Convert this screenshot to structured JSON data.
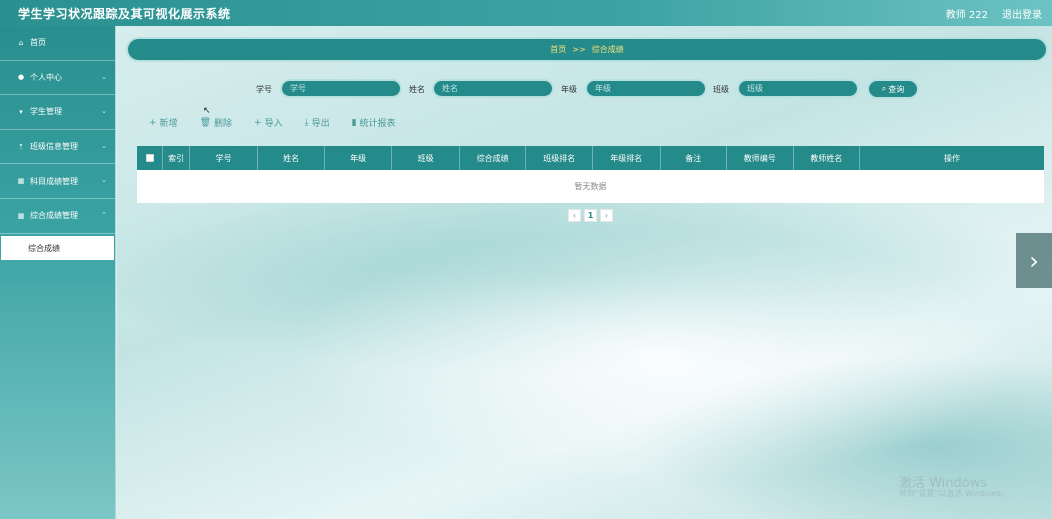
{
  "header": {
    "title": "学生学习状况跟踪及其可视化展示系统",
    "user": "教师 222",
    "logout": "退出登录"
  },
  "sidebar": {
    "items": [
      {
        "label": "首页",
        "icon": "home-icon",
        "has_children": false
      },
      {
        "label": "个人中心",
        "icon": "user-icon",
        "has_children": true
      },
      {
        "label": "学生管理",
        "icon": "student-icon",
        "has_children": true
      },
      {
        "label": "班级信息管理",
        "icon": "upload-icon",
        "has_children": true
      },
      {
        "label": "科目成绩管理",
        "icon": "grid-icon",
        "has_children": true
      },
      {
        "label": "综合成绩管理",
        "icon": "grid-icon",
        "has_children": true
      }
    ],
    "active_sub": "综合成绩"
  },
  "breadcrumb": {
    "home": "首页",
    "sep": ">>",
    "current": "综合成绩"
  },
  "search": {
    "fields": [
      {
        "label": "学号",
        "placeholder": "学号"
      },
      {
        "label": "姓名",
        "placeholder": "姓名"
      },
      {
        "label": "年级",
        "placeholder": "年级"
      },
      {
        "label": "班级",
        "placeholder": "班级"
      }
    ],
    "query_label": "查询"
  },
  "toolbar": {
    "add": "新增",
    "delete": "删除",
    "import": "导入",
    "export": "导出",
    "report": "统计报表"
  },
  "table": {
    "columns": [
      "索引",
      "学号",
      "姓名",
      "年级",
      "班级",
      "综合成绩",
      "班级排名",
      "年级排名",
      "备注",
      "教师编号",
      "教师姓名",
      "操作"
    ],
    "empty_text": "暂无数据"
  },
  "pager": {
    "prev": "‹",
    "page": "1",
    "next": "›"
  },
  "watermark": {
    "line1": "激活 Windows",
    "line2": "转到\"设置\"以激活 Windows。"
  }
}
